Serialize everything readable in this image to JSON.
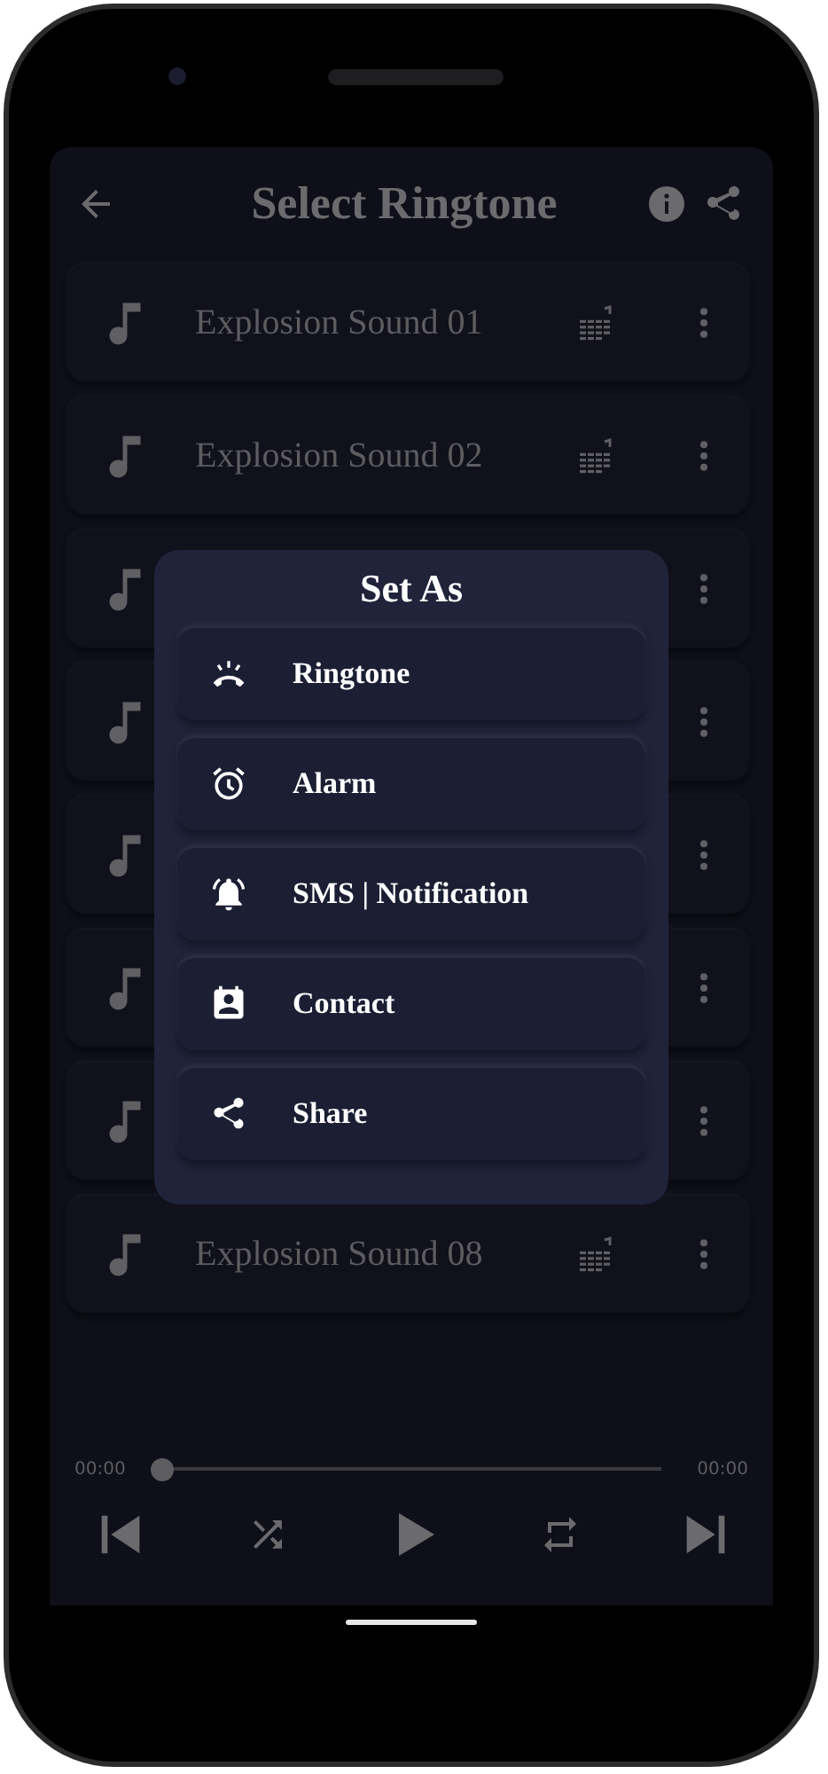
{
  "header": {
    "title": "Select Ringtone"
  },
  "sounds": [
    {
      "kind": "sound",
      "name": "Explosion Sound 01"
    },
    {
      "kind": "sound",
      "name": "Explosion Sound 02"
    },
    {
      "kind": "covered"
    },
    {
      "kind": "covered"
    },
    {
      "kind": "covered"
    },
    {
      "kind": "covered"
    },
    {
      "kind": "covered"
    },
    {
      "kind": "sound",
      "name": "Explosion Sound 08"
    }
  ],
  "dialog": {
    "title": "Set As",
    "options": [
      {
        "kind": "ringtone",
        "label": "Ringtone"
      },
      {
        "kind": "alarm",
        "label": "Alarm"
      },
      {
        "kind": "notification",
        "label": "SMS | Notification"
      },
      {
        "kind": "contact",
        "label": "Contact"
      },
      {
        "kind": "share",
        "label": "Share"
      }
    ]
  },
  "player": {
    "elapsed": "00:00",
    "total": "00:00",
    "level": 0
  }
}
